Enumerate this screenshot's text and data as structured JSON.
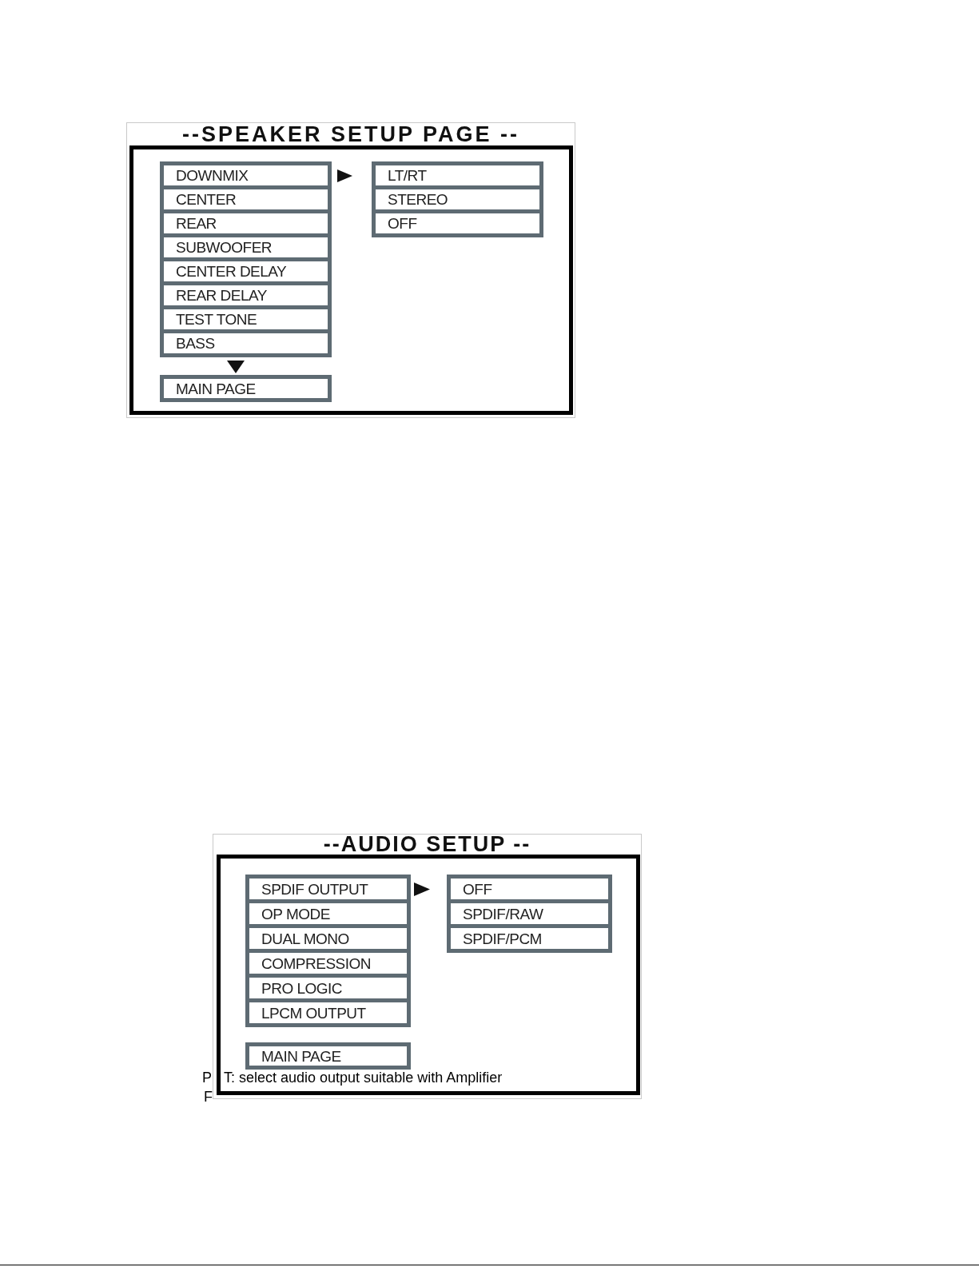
{
  "figures": [
    {
      "title": "--SPEAKER SETUP PAGE --",
      "menu_items": [
        {
          "label": "DOWNMIX",
          "selected": true
        },
        {
          "label": "CENTER",
          "selected": false
        },
        {
          "label": "REAR",
          "selected": false
        },
        {
          "label": "SUBWOOFER",
          "selected": false
        },
        {
          "label": "CENTER DELAY",
          "selected": false
        },
        {
          "label": "REAR DELAY",
          "selected": false
        },
        {
          "label": "TEST TONE",
          "selected": false
        },
        {
          "label": "BASS",
          "selected": false
        }
      ],
      "more_below": true,
      "options": [
        "LT/RT",
        "STEREO",
        "OFF"
      ],
      "main_page": "MAIN PAGE"
    },
    {
      "title": "--AUDIO SETUP --",
      "menu_items": [
        {
          "label": "SPDIF OUTPUT",
          "selected": true
        },
        {
          "label": "OP MODE",
          "selected": false
        },
        {
          "label": "DUAL MONO",
          "selected": false
        },
        {
          "label": "COMPRESSION",
          "selected": false
        },
        {
          "label": "PRO LOGIC",
          "selected": false
        },
        {
          "label": "LPCM OUTPUT",
          "selected": false
        }
      ],
      "more_below": false,
      "options": [
        "OFF",
        "SPDIF/RAW",
        "SPDIF/PCM"
      ],
      "main_page": "MAIN PAGE"
    }
  ],
  "overlapping_text": [
    "P",
    "T: select audio output suitable with Amplifier",
    "F"
  ]
}
